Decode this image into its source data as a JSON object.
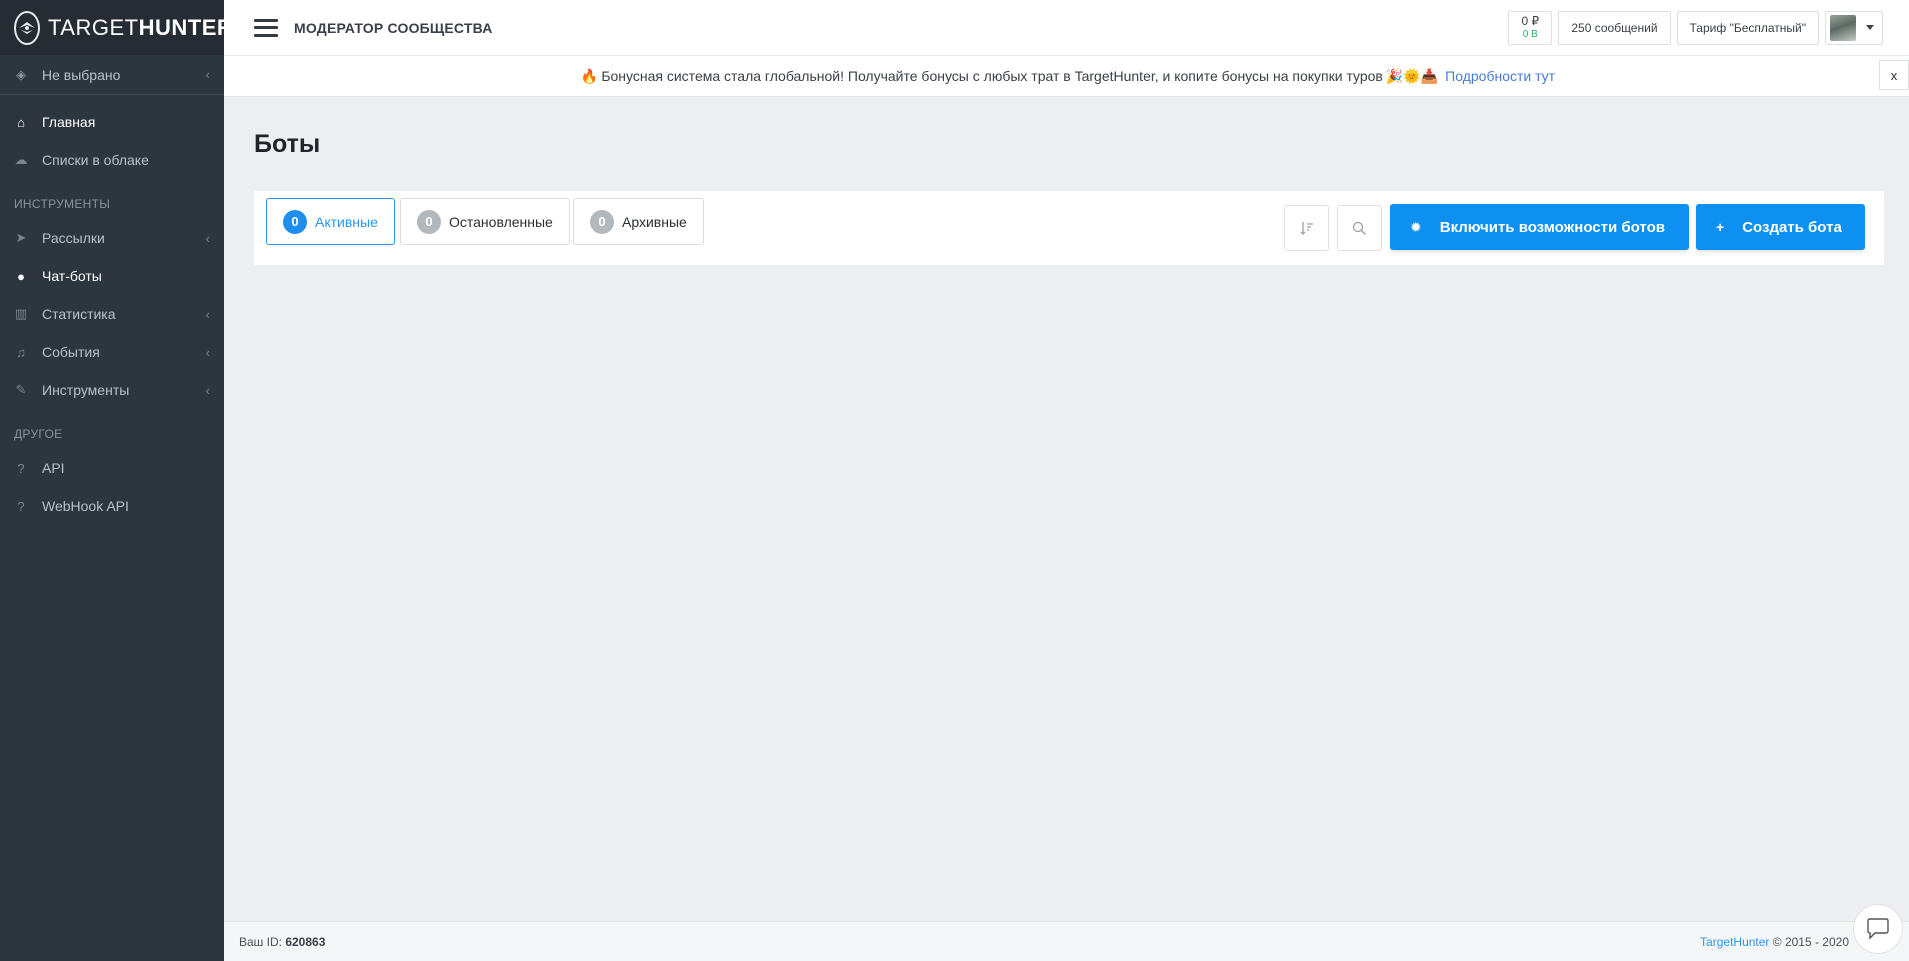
{
  "app": {
    "brand_bold": "TARGET",
    "brand_light": "HUNTER",
    "icon": "targethunter-logo"
  },
  "sidebar": {
    "selector": {
      "label": "Не выбрано",
      "icon": "layers-icon"
    },
    "items": [
      {
        "label": "Главная",
        "icon": "home-icon",
        "active": true
      },
      {
        "label": "Списки в облаке",
        "icon": "cloud-icon"
      }
    ],
    "section_tools": "ИНСТРУМЕНТЫ",
    "tools": [
      {
        "label": "Рассылки",
        "icon": "send-icon",
        "has_submenu": true
      },
      {
        "label": "Чат-боты",
        "icon": "bot-icon",
        "active": true
      },
      {
        "label": "Статистика",
        "icon": "chart-icon",
        "has_submenu": true
      },
      {
        "label": "События",
        "icon": "bell-icon",
        "has_submenu": true
      },
      {
        "label": "Инструменты",
        "icon": "wrench-icon",
        "has_submenu": true
      }
    ],
    "section_other": "ДРУГОЕ",
    "other": [
      {
        "label": "API",
        "icon": "help-icon"
      },
      {
        "label": "WebHook API",
        "icon": "help-icon"
      }
    ]
  },
  "header": {
    "title": "МОДЕРАТОР СООБЩЕСТВА",
    "balance_rub": "0 ₽",
    "balance_bonus": "0 B",
    "messages": "250 сообщений",
    "tariff": "Тариф \"Бесплатный\""
  },
  "notice": {
    "text": "Бонусная система стала глобальной! Получайте бонусы с любых трат в TargetHunter, и копите бонусы на покупки туров",
    "link": "Подробности тут",
    "close": "x",
    "emoji_before": "🔥",
    "emoji_after": "🎉🌞📥"
  },
  "main": {
    "title": "Боты",
    "tabs": [
      {
        "count": "0",
        "label": "Активные",
        "active": true
      },
      {
        "count": "0",
        "label": "Остановленные"
      },
      {
        "count": "0",
        "label": "Архивные"
      }
    ],
    "enable_button": "Включить возможности ботов",
    "create_button": "Создать бота",
    "colors": {
      "accent": "#0e90f0",
      "sidebar": "#2d353e"
    }
  },
  "footer": {
    "id_label": "Ваш ID:",
    "id_value": "620863",
    "brand": "TargetHunter",
    "copyright": "© 2015 - 2020"
  }
}
